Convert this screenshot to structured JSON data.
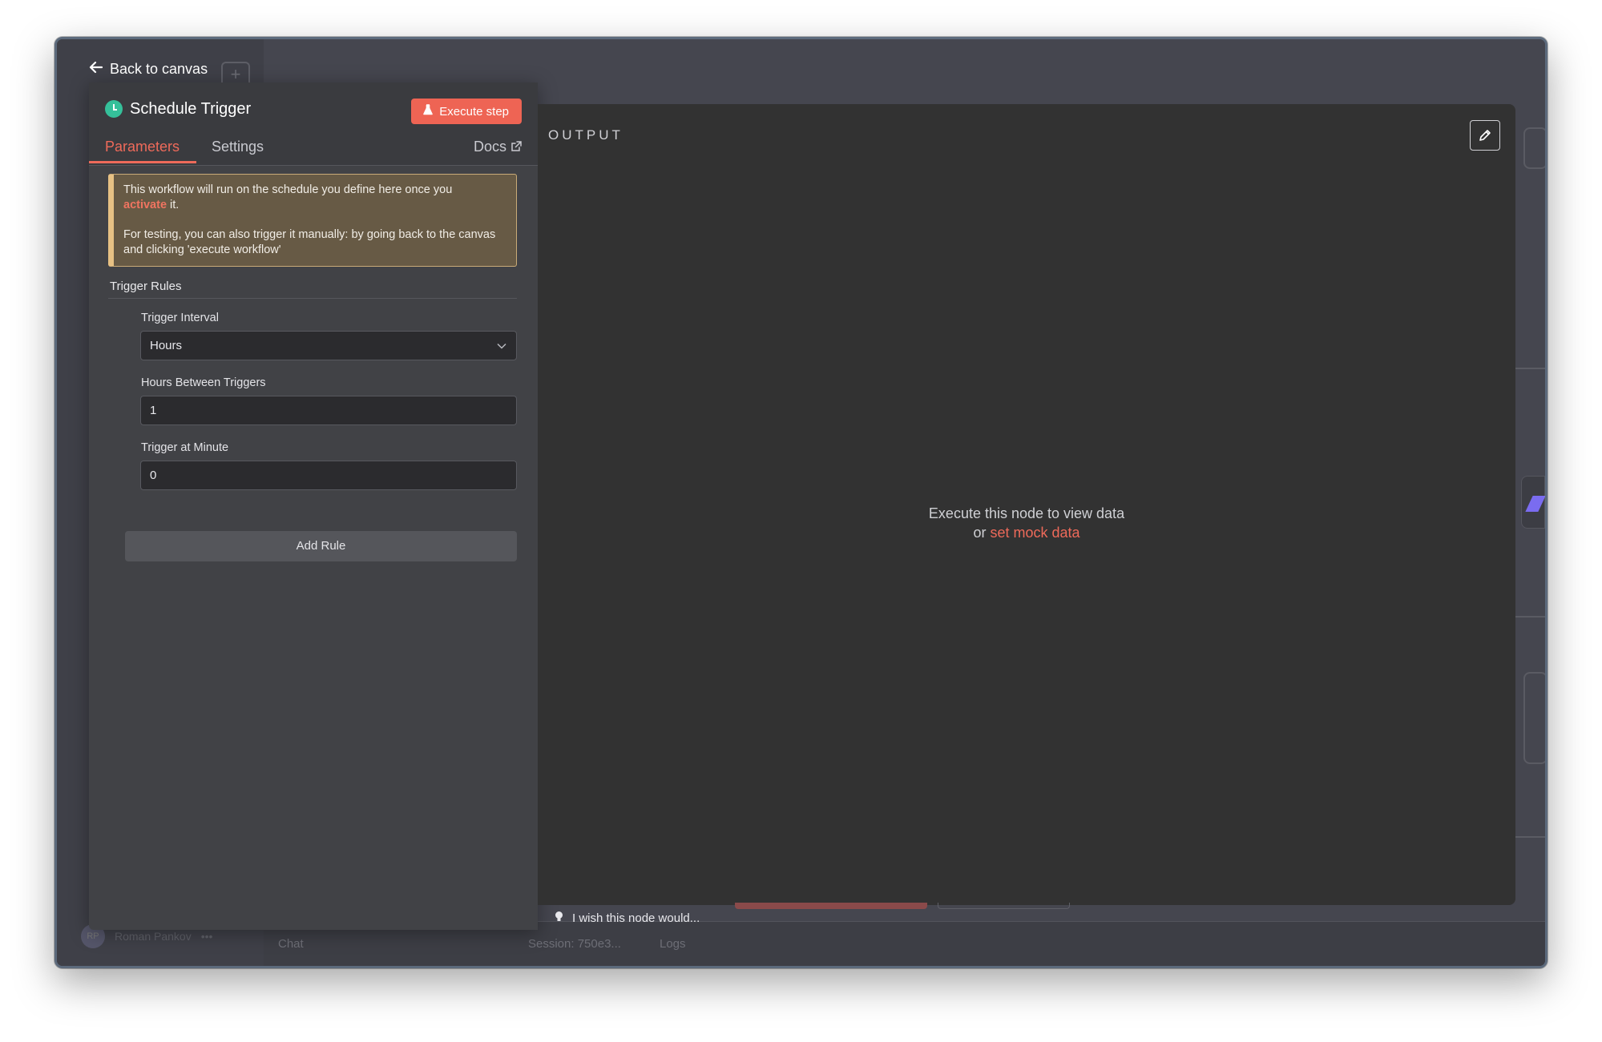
{
  "back_link": {
    "label": "Back to canvas"
  },
  "node": {
    "title": "Schedule Trigger",
    "execute_label": "Execute step",
    "tabs": [
      {
        "label": "Parameters",
        "active": true
      },
      {
        "label": "Settings",
        "active": false
      }
    ],
    "docs_label": "Docs"
  },
  "notice": {
    "line1_before": "This workflow will run on the schedule you define here once you",
    "activate_link": "activate",
    "line1_after": " it.",
    "line2": "For testing, you can also trigger it manually: by going back to the canvas and clicking 'execute workflow'"
  },
  "trigger_rules": {
    "title": "Trigger Rules",
    "interval_label": "Trigger Interval",
    "interval_value": "Hours",
    "hours_label": "Hours Between Triggers",
    "hours_value": "1",
    "minute_label": "Trigger at Minute",
    "minute_value": "0",
    "add_rule_label": "Add Rule"
  },
  "output": {
    "label": "OUTPUT",
    "empty_line1": "Execute this node to view data",
    "empty_or": "or ",
    "mock_link": "set mock data"
  },
  "feedback": {
    "label": "I wish this node would..."
  },
  "background": {
    "user_name": "Roman Pankov",
    "user_initials": "RP",
    "chat_label": "Chat",
    "session_label": "Session: 750e3...",
    "logs_label": "Logs"
  },
  "colors": {
    "accent": "#ee6a5a",
    "execute_button": "#ee6454",
    "trigger_icon": "#35c09a",
    "notice_bg": "#675a45",
    "notice_border": "#e7c184"
  },
  "icons": {
    "back": "arrow-left-icon",
    "execute": "flask-icon",
    "docs": "external-link-icon",
    "select": "chevron-down-icon",
    "edit": "pencil-icon",
    "feedback": "lightbulb-icon"
  }
}
